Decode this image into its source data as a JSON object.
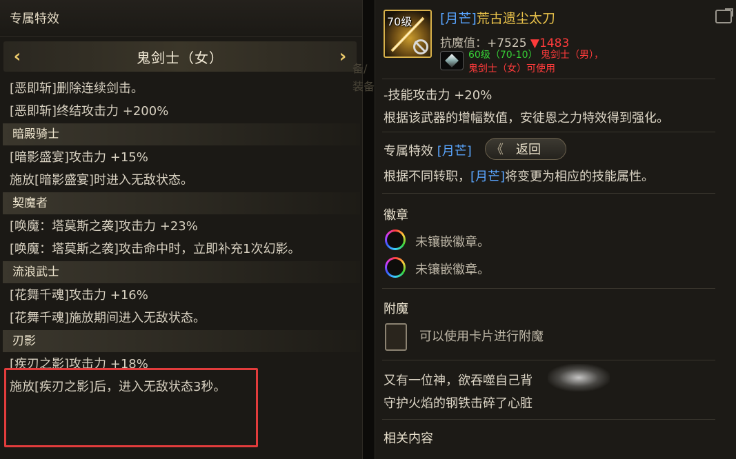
{
  "left": {
    "header": "专属特效",
    "class_selector": {
      "prev": "‹",
      "title": "鬼剑士（女）",
      "next": "›"
    },
    "intro_lines": [
      "[恶即斩]删除连续剑击。",
      "[恶即斩]终结攻击力 +200%"
    ],
    "sections": [
      {
        "title": "暗殿骑士",
        "lines": [
          "[暗影盛宴]攻击力 +15%",
          "施放[暗影盛宴]时进入无敌状态。"
        ]
      },
      {
        "title": "契魔者",
        "lines": [
          "[唤魔：塔莫斯之袭]攻击力 +23%",
          "[唤魔：塔莫斯之袭]攻击命中时，立即补充1次幻影。"
        ]
      },
      {
        "title": "流浪武士",
        "lines": [
          "[花舞千魂]攻击力 +16%",
          "[花舞千魂]施放期间进入无敌状态。"
        ]
      },
      {
        "title": "刃影",
        "lines": [
          "[疾刃之影]攻击力 +18%",
          "施放[疾刃之影]后，进入无敌状态3秒。"
        ]
      }
    ]
  },
  "background_fragments": [
    "备/",
    "装备"
  ],
  "right": {
    "item": {
      "level": "70级",
      "name_tag": "[月芒]",
      "name": "荒古遗尘太刀",
      "resist_label": "抗魔值：",
      "resist_value": "+7525",
      "resist_diff": "▼1483",
      "req_level": "60级（70-10）",
      "req_class1": "鬼剑士（男），",
      "req_class2": "鬼剑士（女）可使用"
    },
    "effect_lines": [
      "-技能攻击力 +20%",
      "根据该武器的增幅数值，安徒恩之力特效得到强化。"
    ],
    "exclusive": {
      "label": "专属特效",
      "tag": "[月芒]",
      "return_chevrons": "《",
      "return_label": "返回",
      "desc_prefix": "根据不同转职，",
      "desc_tag": "[月芒]",
      "desc_suffix": "将变更为相应的技能属性。"
    },
    "emblem": {
      "title": "徽章",
      "slots": [
        "未镶嵌徽章。",
        "未镶嵌徽章。"
      ]
    },
    "enchant": {
      "title": "附魔",
      "text": "可以使用卡片进行附魔"
    },
    "lore": [
      "又有一位神，欲吞噬自己背",
      "守护火焰的钢铁击碎了心脏"
    ],
    "related": "相关内容"
  },
  "colors": {
    "highlight": "#e23c3c",
    "gold": "#e9c24a",
    "blue_tag": "#5aa6ff",
    "green": "#37d337",
    "red": "#ff3b3b"
  }
}
